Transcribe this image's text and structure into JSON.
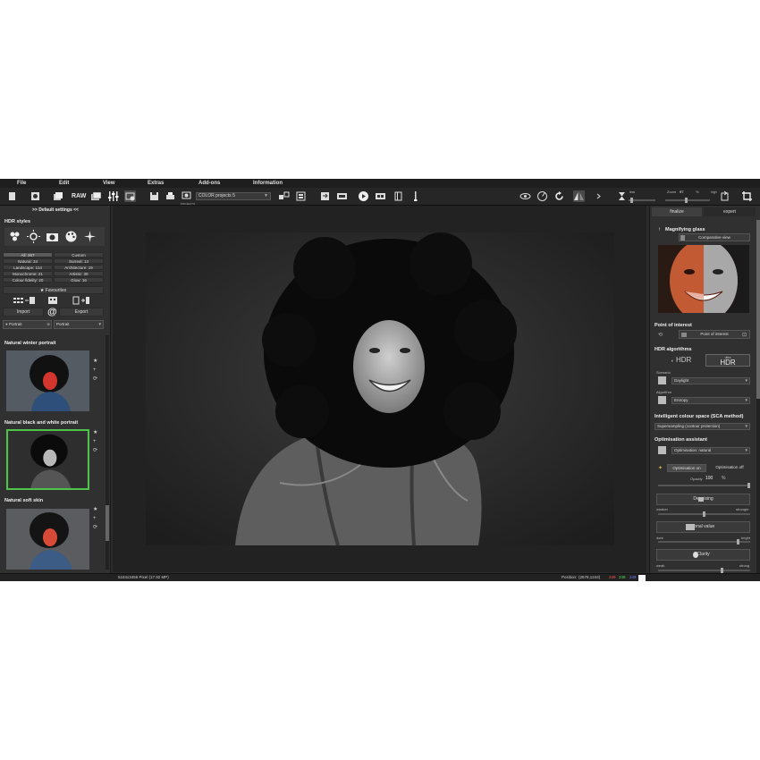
{
  "menu": [
    "File",
    "Edit",
    "View",
    "Extras",
    "Add-ons",
    "Information"
  ],
  "toolbar": {
    "raw_label": "RAW",
    "project_select": "COLOR projects 5",
    "projects_caption": "PROJECTS",
    "zoom_label": "Zoom",
    "zoom_value": "97",
    "zoom_unit": "%",
    "size_less": "less",
    "size_high": "high"
  },
  "left": {
    "header": ">> Default settings <<",
    "hdr_styles": "HDR styles",
    "categories": [
      [
        "All: 267",
        "Custom"
      ],
      [
        "Natural: 34",
        "Surreal: 13"
      ],
      [
        "Landscape: 114",
        "Architecture: 19"
      ],
      [
        "Monochrome: 21",
        "Artistic: 30"
      ],
      [
        "Colour fidelity: 20",
        "Glow: 16"
      ]
    ],
    "favourites": "Favourites",
    "import": "Import",
    "export": "Export",
    "filter1": "Portrait",
    "filter2": "Portrait",
    "presets": [
      {
        "title": "Natural winter portrait"
      },
      {
        "title": "Natural black and white portrait"
      },
      {
        "title": "Natural soft skin"
      }
    ]
  },
  "right": {
    "tab_finalize": "finalize",
    "tab_expert": "expert",
    "magnifying_glass": "Magnifying glass",
    "comparative_view": "Comparative view",
    "point_of_interest_title": "Point of interest",
    "point_of_interest_btn": "Point of interest",
    "hdr_algorithms": "HDR algorithms",
    "hdr_label": "HDR",
    "ultra_label": "ultra",
    "scenario_label": "Scenario",
    "scenario_value": "Daylight",
    "algorithm_label": "Algorithm",
    "algorithm_value": "Entropy",
    "intelligent_colour": "Intelligent colour space (SCA method)",
    "supersampling": "Supersampling (contour protection)",
    "optimisation_assistant": "Optimisation assistant",
    "optimisation_value": "Optimisation: natural",
    "opt_on": "Optimisation on",
    "opt_off": "Optimisation off",
    "opacity_label": "Opacity",
    "opacity_value": "100",
    "opacity_unit": "%",
    "denoising": "Denoising",
    "weaker": "weaker",
    "stronger": "stronger",
    "tonal_value": "Tonal value",
    "dark": "dark",
    "bright": "bright",
    "clarity": "Clarity",
    "weak": "weak",
    "strong": "strong"
  },
  "status": {
    "size": "5184x3456 Pixel (17.92 MP)",
    "position_label": "Position:",
    "position_value": "(2678,1244)",
    "r": "249",
    "g": "249",
    "b": "249"
  },
  "colors": {
    "accent_green": "#4fc24a",
    "status_r": "#ff5555",
    "status_g": "#55dd55",
    "status_b": "#6a7dff"
  }
}
